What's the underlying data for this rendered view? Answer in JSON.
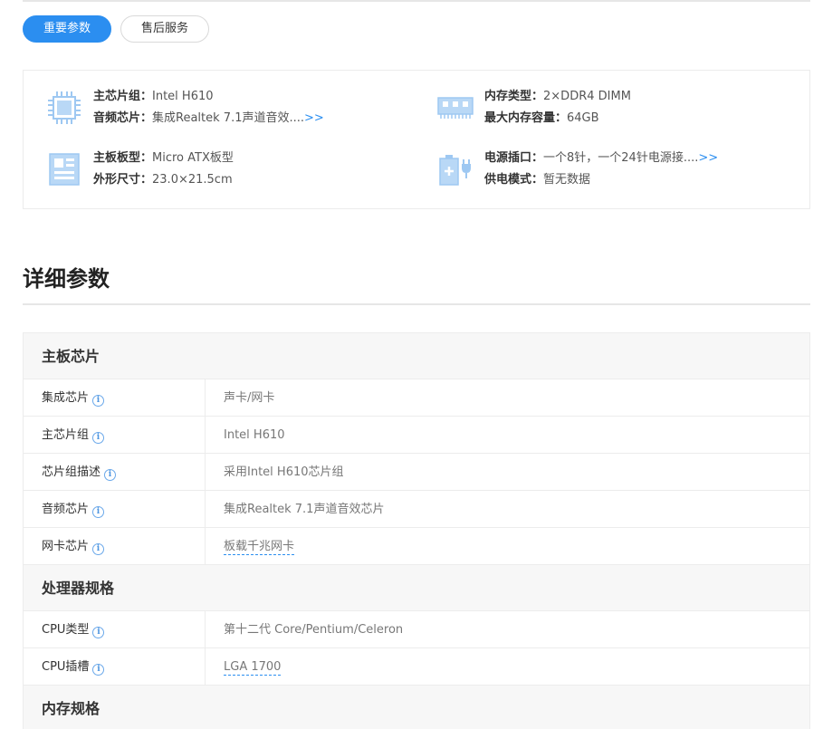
{
  "tabs": [
    {
      "label": "重要参数",
      "active": true
    },
    {
      "label": "售后服务",
      "active": false
    }
  ],
  "key_params": [
    {
      "icon": "chip-icon",
      "lines": [
        {
          "key": "主芯片组：",
          "value": "Intel H610",
          "more": ""
        },
        {
          "key": "音频芯片：",
          "value": "集成Realtek 7.1声道音效....",
          "more": ">>"
        }
      ]
    },
    {
      "icon": "memory-icon",
      "lines": [
        {
          "key": "内存类型：",
          "value": "2×DDR4 DIMM",
          "more": ""
        },
        {
          "key": "最大内存容量：",
          "value": "64GB",
          "more": ""
        }
      ]
    },
    {
      "icon": "motherboard-icon",
      "lines": [
        {
          "key": "主板板型：",
          "value": "Micro ATX板型",
          "more": ""
        },
        {
          "key": "外形尺寸：",
          "value": "23.0×21.5cm",
          "more": ""
        }
      ]
    },
    {
      "icon": "power-icon",
      "lines": [
        {
          "key": "电源插口：",
          "value": "一个8针，一个24针电源接....",
          "more": ">>"
        },
        {
          "key": "供电模式：",
          "value": "暂无数据",
          "more": ""
        }
      ]
    }
  ],
  "section_title": "详细参数",
  "spec_groups": [
    {
      "title": "主板芯片",
      "rows": [
        {
          "label": "集成芯片",
          "value": "声卡/网卡",
          "linked": false
        },
        {
          "label": "主芯片组",
          "value": "Intel H610",
          "linked": false
        },
        {
          "label": "芯片组描述",
          "value": "采用Intel H610芯片组",
          "linked": false
        },
        {
          "label": "音频芯片",
          "value": "集成Realtek 7.1声道音效芯片",
          "linked": false
        },
        {
          "label": "网卡芯片",
          "value": "板载千兆网卡",
          "linked": true
        }
      ]
    },
    {
      "title": "处理器规格",
      "rows": [
        {
          "label": "CPU类型",
          "value": "第十二代 Core/Pentium/Celeron",
          "linked": false
        },
        {
          "label": "CPU插槽",
          "value": "LGA 1700",
          "linked": true
        }
      ]
    },
    {
      "title": "内存规格",
      "rows": []
    }
  ],
  "info_icon_glyph": "i",
  "colors": {
    "accent": "#2b8ef0",
    "icon": "#9ec8f2"
  }
}
